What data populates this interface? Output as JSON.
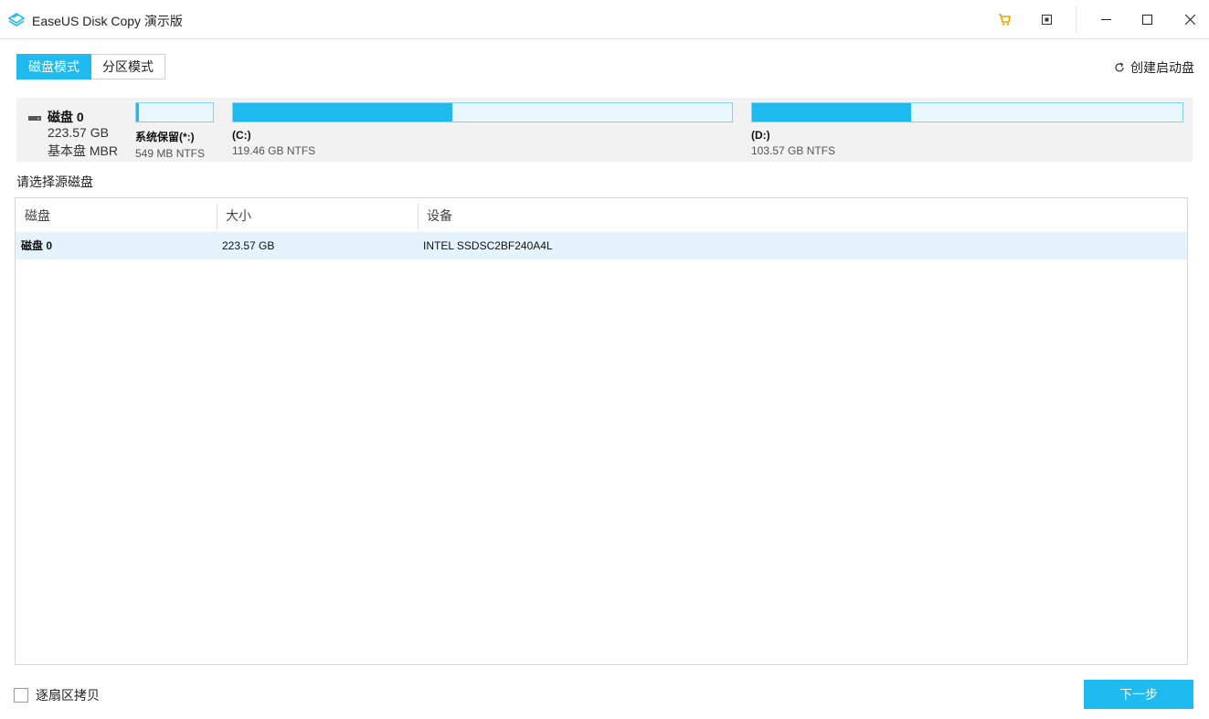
{
  "titlebar": {
    "title": "EaseUS Disk Copy 演示版",
    "icons": [
      "app-logo-icon",
      "cart-icon",
      "pin-icon",
      "minimize-icon",
      "maximize-icon",
      "close-icon"
    ],
    "cart_color": "#f0a000"
  },
  "modes": {
    "disk_mode": "磁盘模式",
    "partition_mode": "分区模式",
    "active": "disk_mode"
  },
  "create_boot_label": "创建启动盘",
  "disk_map": {
    "name": "磁盘 0",
    "size": "223.57 GB",
    "type": "基本盘 MBR",
    "partitions": [
      {
        "label": "系统保留(*:)",
        "info": "549 MB NTFS",
        "used_fraction": 0.03
      },
      {
        "label": "(C:)",
        "info": "119.46 GB NTFS",
        "used_fraction": 0.44
      },
      {
        "label": "(D:)",
        "info": "103.57 GB NTFS",
        "used_fraction": 0.37
      }
    ]
  },
  "select_label": "请选择源磁盘",
  "table": {
    "headers": [
      "磁盘",
      "大小",
      "设备"
    ],
    "rows": [
      {
        "disk": "磁盘 0",
        "size": "223.57 GB",
        "device": "INTEL SSDSC2BF240A4L",
        "selected": true
      }
    ]
  },
  "footer": {
    "sector_copy_label": "逐扇区拷贝",
    "sector_copy_checked": false,
    "next_label": "下一步"
  },
  "colors": {
    "accent": "#1ebaf0",
    "partition_bg": "#e8f6fd",
    "selected_row": "#e5f3fc",
    "disk_map_bg": "#f2f2f2"
  }
}
